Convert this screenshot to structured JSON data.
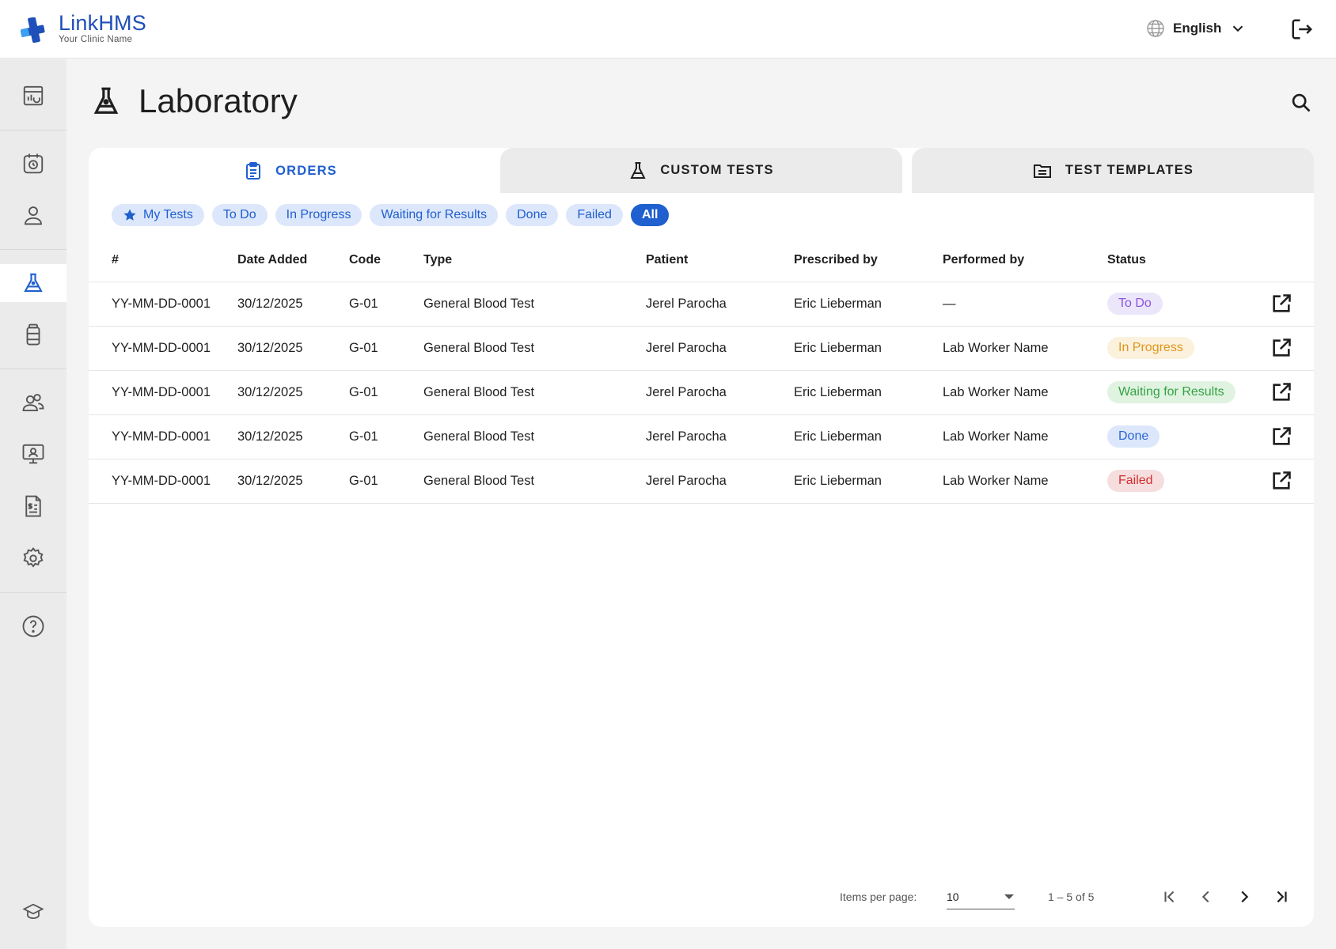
{
  "app": {
    "name_primary": "Link",
    "name_secondary": "HMS",
    "clinic_name": "Your Clinic Name"
  },
  "header": {
    "language_label": "English",
    "icons": [
      "globe-icon",
      "chevron-down-icon",
      "logout-icon"
    ]
  },
  "sidebar": {
    "items": [
      {
        "name": "dashboard-icon"
      },
      {
        "name": "appointments-icon"
      },
      {
        "name": "patients-icon"
      },
      {
        "name": "laboratory-icon",
        "active": true
      },
      {
        "name": "pharmacy-icon"
      },
      {
        "name": "staff-icon"
      },
      {
        "name": "monitor-icon"
      },
      {
        "name": "billing-icon"
      },
      {
        "name": "settings-icon"
      },
      {
        "name": "help-icon"
      },
      {
        "name": "education-icon"
      }
    ]
  },
  "page": {
    "title": "Laboratory"
  },
  "tabs": [
    {
      "label": "ORDERS",
      "active": true
    },
    {
      "label": "CUSTOM TESTS",
      "active": false
    },
    {
      "label": "TEST TEMPLATES",
      "active": false
    }
  ],
  "filters": [
    {
      "label": "My Tests",
      "icon": "star-icon"
    },
    {
      "label": "To Do"
    },
    {
      "label": "In Progress"
    },
    {
      "label": "Waiting for Results"
    },
    {
      "label": "Done"
    },
    {
      "label": "Failed"
    },
    {
      "label": "All",
      "selected": true
    }
  ],
  "table": {
    "columns": [
      "#",
      "Date Added",
      "Code",
      "Type",
      "Patient",
      "Prescribed by",
      "Performed by",
      "Status"
    ],
    "rows": [
      {
        "id": "YY-MM-DD-0001",
        "date": "30/12/2025",
        "code": "G-01",
        "type": "General Blood Test",
        "patient": "Jerel Parocha",
        "prescribed_by": "Eric Lieberman",
        "performed_by": "—",
        "status": "To Do"
      },
      {
        "id": "YY-MM-DD-0001",
        "date": "30/12/2025",
        "code": "G-01",
        "type": "General Blood Test",
        "patient": "Jerel Parocha",
        "prescribed_by": "Eric Lieberman",
        "performed_by": "Lab Worker Name",
        "status": "In Progress"
      },
      {
        "id": "YY-MM-DD-0001",
        "date": "30/12/2025",
        "code": "G-01",
        "type": "General Blood Test",
        "patient": "Jerel Parocha",
        "prescribed_by": "Eric Lieberman",
        "performed_by": "Lab Worker Name",
        "status": "Waiting for Results"
      },
      {
        "id": "YY-MM-DD-0001",
        "date": "30/12/2025",
        "code": "G-01",
        "type": "General Blood Test",
        "patient": "Jerel Parocha",
        "prescribed_by": "Eric Lieberman",
        "performed_by": "Lab Worker Name",
        "status": "Done"
      },
      {
        "id": "YY-MM-DD-0001",
        "date": "30/12/2025",
        "code": "G-01",
        "type": "General Blood Test",
        "patient": "Jerel Parocha",
        "prescribed_by": "Eric Lieberman",
        "performed_by": "Lab Worker Name",
        "status": "Failed"
      }
    ]
  },
  "status_colors": {
    "To Do": {
      "bg": "#ece6fb",
      "fg": "#8a55e0"
    },
    "In Progress": {
      "bg": "#fbf1dc",
      "fg": "#e0961c"
    },
    "Waiting for Results": {
      "bg": "#e0f3e1",
      "fg": "#36a244"
    },
    "Done": {
      "bg": "#dde7fb",
      "fg": "#2a66d6"
    },
    "Failed": {
      "bg": "#f6dede",
      "fg": "#d22f2f"
    }
  },
  "pagination": {
    "items_per_page_label": "Items per page:",
    "items_per_page_value": "10",
    "range_label": "1 – 5 of 5"
  },
  "colors": {
    "accent": "#1f5fcf",
    "brand": "#1f4fb8"
  }
}
